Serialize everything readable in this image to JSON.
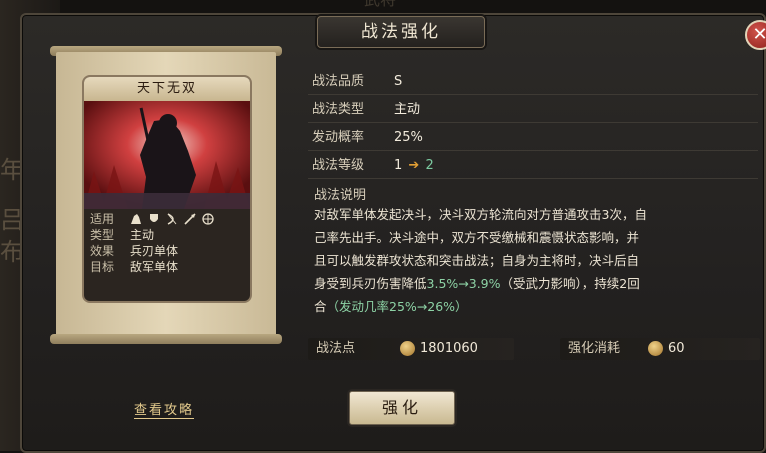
{
  "background": {
    "left_glyphs": [
      "年",
      "吕",
      "布"
    ],
    "top_glyph": "武将"
  },
  "dialog": {
    "title": "战法强化",
    "close_icon": "close-icon"
  },
  "card": {
    "title": "天下无双",
    "rows": [
      {
        "key": "适用",
        "value": "",
        "icons": [
          "cavalry-icon",
          "shield-icon",
          "bow-icon",
          "spear-icon",
          "wheel-icon"
        ]
      },
      {
        "key": "类型",
        "value": "主动"
      },
      {
        "key": "效果",
        "value": "兵刃单体"
      },
      {
        "key": "目标",
        "value": "敌军单体"
      }
    ]
  },
  "info": {
    "quality_label": "战法品质",
    "quality_value": "S",
    "type_label": "战法类型",
    "type_value": "主动",
    "rate_label": "发动概率",
    "rate_value": "25%",
    "level_label": "战法等级",
    "level_from": "1",
    "level_to": "2"
  },
  "description": {
    "title": "战法说明",
    "line1": "对敌军单体发起决斗，决斗双方轮流向对方普通攻击3次，自",
    "line2": "己率先出手。决斗途中，双方不受缴械和震慑状态影响，并",
    "line3": "且可以触发群攻状态和突击战法；自身为主将时，决斗后自",
    "line4_a": "身受到兵刃伤害降低",
    "line4_green": "3.5%→3.9%",
    "line4_b": "（受武力影响），持续2回",
    "line5_a": "合",
    "line5_green": "（发动几率25%→26%）"
  },
  "costs": {
    "points_label": "战法点",
    "points_value": "1801060",
    "consume_label": "强化消耗",
    "consume_value": "60"
  },
  "actions": {
    "guide_link": "查看攻略",
    "upgrade_button": "强化"
  },
  "colors": {
    "accent_green": "#7ccba0",
    "arrow_orange": "#e3a035",
    "close_red": "#b33a33",
    "gold": "#e2c98c"
  }
}
